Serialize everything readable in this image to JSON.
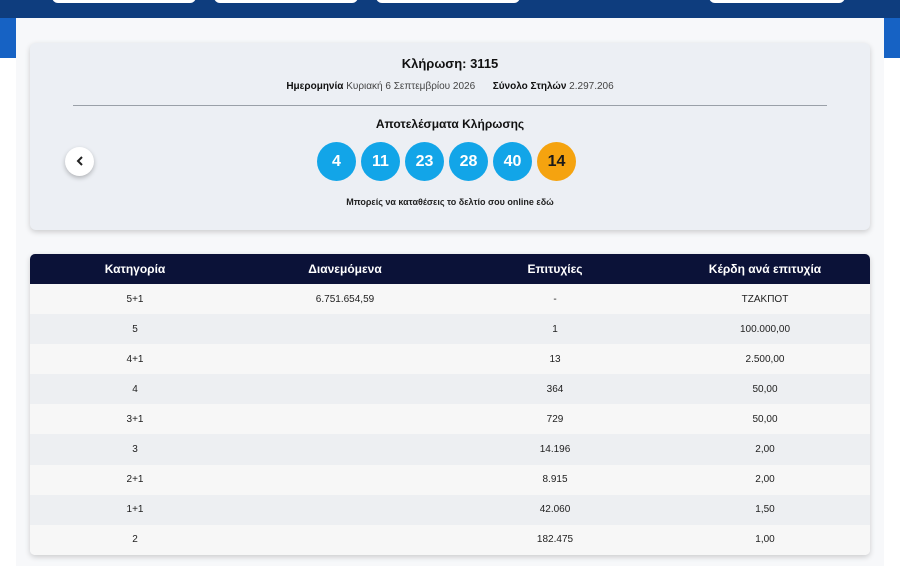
{
  "draw": {
    "title": "Κλήρωση: 3115",
    "date_label": "Ημερομηνία",
    "date_value": "Κυριακή 6 Σεπτεμβρίου 2026",
    "columns_label": "Σύνολο Στηλών",
    "columns_value": "2.297.206",
    "results_title": "Αποτελέσματα Κλήρωσης",
    "prev_icon": "chevron-left-icon",
    "numbers": [
      "4",
      "11",
      "23",
      "28",
      "40"
    ],
    "bonus": "14",
    "online_text": "Μπορείς να καταθέσεις το δελτίο σου online εδώ"
  },
  "colors": {
    "header_blue": "#1662c4",
    "ball_blue": "#12a5e8",
    "ball_orange": "#f5a30f",
    "table_header": "#0b1238"
  },
  "table": {
    "headers": [
      "Κατηγορία",
      "Διανεμόμενα",
      "Επιτυχίες",
      "Κέρδη ανά επιτυχία"
    ],
    "rows": [
      [
        "5+1",
        "6.751.654,59",
        "-",
        "ΤΖΑΚΠΟΤ"
      ],
      [
        "5",
        "",
        "1",
        "100.000,00"
      ],
      [
        "4+1",
        "",
        "13",
        "2.500,00"
      ],
      [
        "4",
        "",
        "364",
        "50,00"
      ],
      [
        "3+1",
        "",
        "729",
        "50,00"
      ],
      [
        "3",
        "",
        "14.196",
        "2,00"
      ],
      [
        "2+1",
        "",
        "8.915",
        "2,00"
      ],
      [
        "1+1",
        "",
        "42.060",
        "1,50"
      ],
      [
        "2",
        "",
        "182.475",
        "1,00"
      ]
    ]
  }
}
